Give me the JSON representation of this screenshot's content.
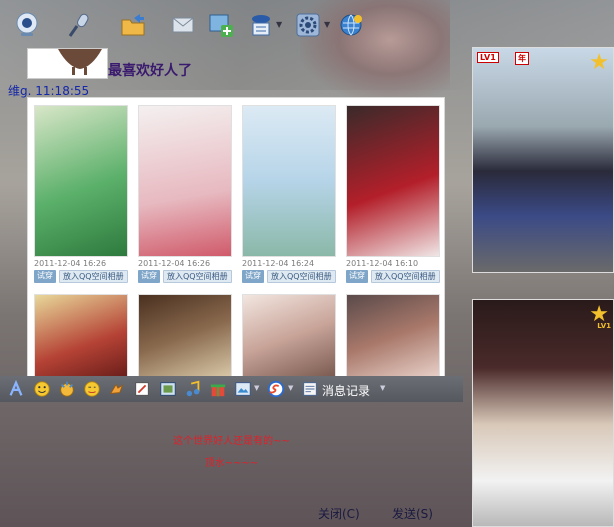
{
  "header": {
    "nickname": "最喜欢好人了",
    "status": "维g.  11:18:55"
  },
  "toolbar": {
    "icons": [
      "webcam-icon",
      "microphone-icon",
      "folder-send-icon",
      "mail-icon",
      "add-app-icon",
      "user-card-icon",
      "settings-gear-icon",
      "browser-icon"
    ]
  },
  "gallery": {
    "cards": [
      {
        "date": "2011-12-04 16:26",
        "try": "试穿",
        "album": "放入QQ空间相册",
        "color": "#5bb06a"
      },
      {
        "date": "2011-12-04 16:26",
        "try": "试穿",
        "album": "放入QQ空间相册",
        "color": "#e7b9c0"
      },
      {
        "date": "2011-12-04 16:24",
        "try": "试穿",
        "album": "放入QQ空间相册",
        "color": "#b6d4e8"
      },
      {
        "date": "2011-12-04 16:10",
        "try": "试穿",
        "album": "放入QQ空间相册",
        "color": "#b31f2a"
      },
      {
        "date": "",
        "try": "",
        "album": "",
        "color": "#b54235"
      },
      {
        "date": "",
        "try": "",
        "album": "",
        "color": "#8a6a4e"
      },
      {
        "date": "",
        "try": "",
        "album": "",
        "color": "#c9a59a"
      },
      {
        "date": "",
        "try": "",
        "album": "",
        "color": "#a8786a"
      }
    ]
  },
  "right_panel": {
    "level_top": "LV1",
    "level_bottom": "LV1",
    "tag": "年"
  },
  "input_toolbar": {
    "history_label": "消息记录"
  },
  "chat": {
    "line1": "这个世界好人还是有的~~",
    "line2": "顶水~~~~"
  },
  "footer": {
    "close_label": "关闭(C)",
    "send_label": "发送(S)"
  }
}
